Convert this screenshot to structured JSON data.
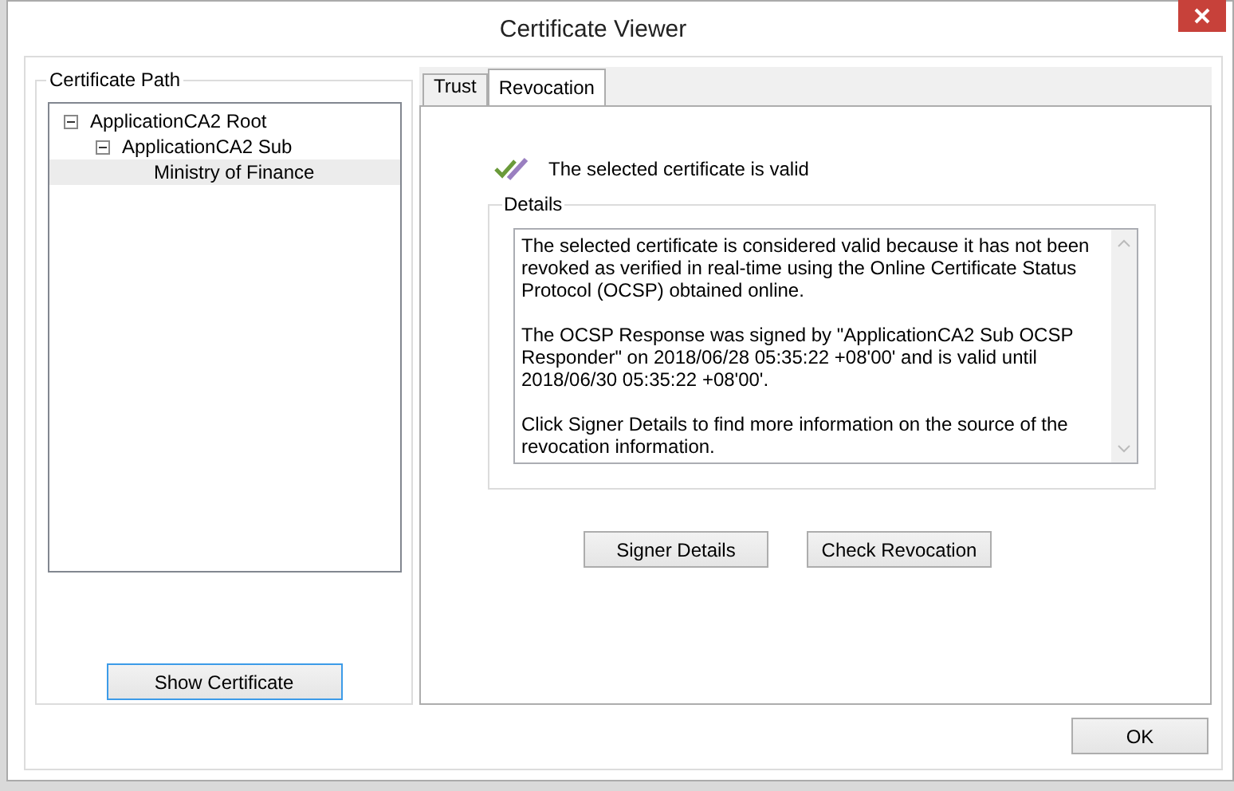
{
  "window": {
    "title": "Certificate Viewer"
  },
  "certificate_path": {
    "label": "Certificate Path",
    "tree": [
      {
        "label": "ApplicationCA2 Root",
        "expanded": true,
        "selected": false,
        "children": [
          {
            "label": "ApplicationCA2 Sub",
            "expanded": true,
            "selected": false,
            "children": [
              {
                "label": "Ministry of Finance",
                "selected": true
              }
            ]
          }
        ]
      }
    ],
    "button": {
      "label": "Show Certificate",
      "focused": true
    }
  },
  "tabs": [
    {
      "label": "Trust",
      "selected": false
    },
    {
      "label": "Revocation",
      "selected": true
    }
  ],
  "revocation": {
    "status": "The selected certificate is valid",
    "valid": true,
    "details_label": "Details",
    "details": [
      "The selected certificate is considered valid because it has not been revoked as verified in real-time using the Online Certificate Status Protocol (OCSP) obtained online.",
      "The OCSP Response was signed by \"ApplicationCA2 Sub OCSP Responder\" on 2018/06/28 05:35:22 +08'00' and is valid until 2018/06/30 05:35:22 +08'00'.",
      "Click Signer Details to find more information on the source of the revocation information."
    ],
    "buttons": [
      {
        "label": "Signer Details",
        "focused": false
      },
      {
        "label": "Check Revocation",
        "focused": false
      }
    ]
  },
  "buttons": [
    {
      "label": "OK",
      "focused": false
    }
  ]
}
